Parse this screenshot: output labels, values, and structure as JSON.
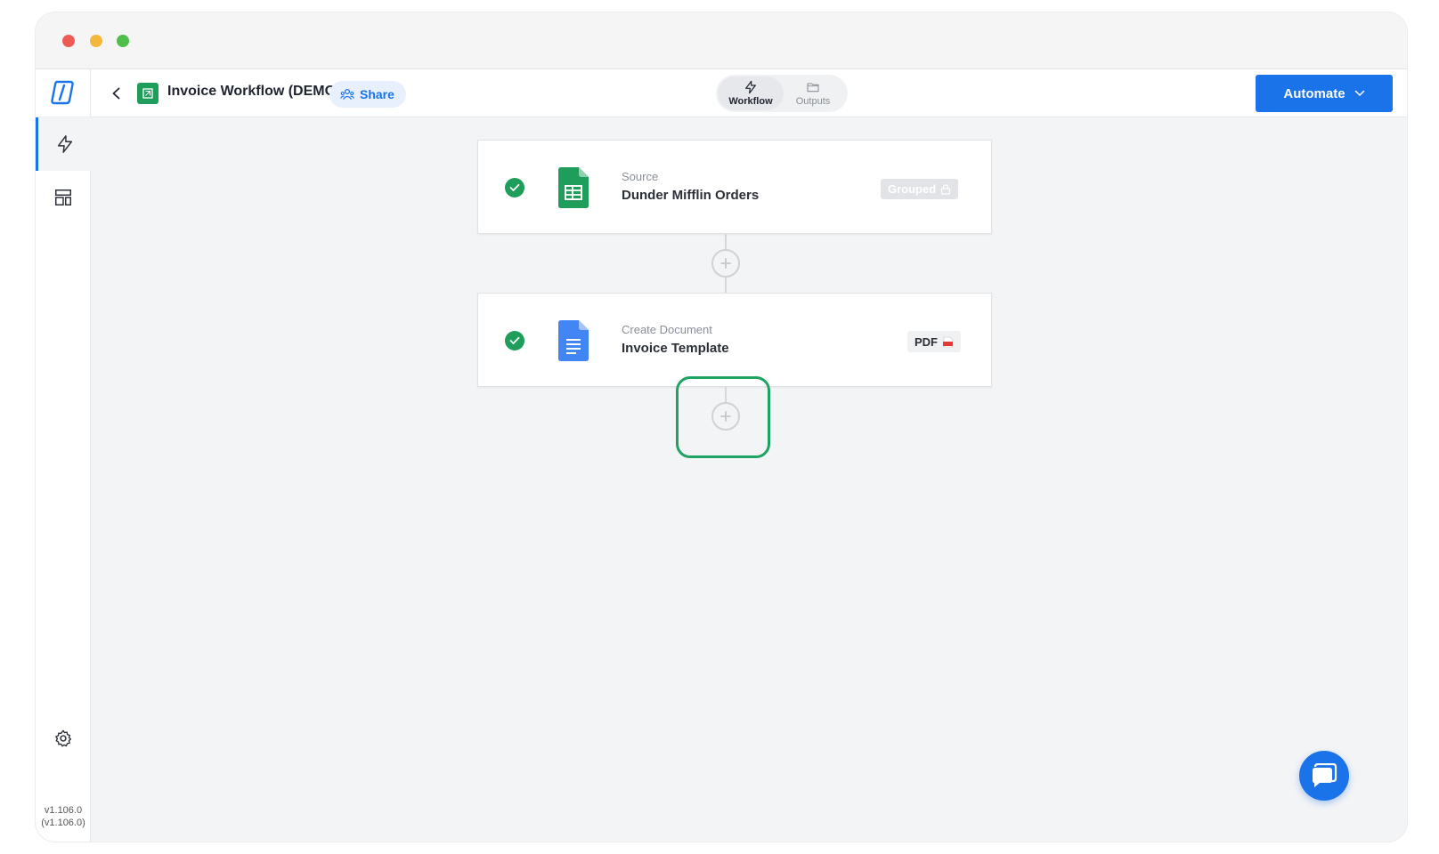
{
  "window": {
    "controls": [
      "close",
      "minimize",
      "zoom"
    ]
  },
  "sidebar": {
    "logo": "app-logo-icon",
    "items": [
      {
        "name": "workflow",
        "icon": "lightning-icon",
        "active": true
      },
      {
        "name": "templates",
        "icon": "layout-icon",
        "active": false
      }
    ],
    "settings_icon": "gear-icon",
    "version": "v1.106.0",
    "build": "(v1.106.0)"
  },
  "header": {
    "title": "Invoice Workflow (DEMO)",
    "share_label": "Share",
    "tabs": [
      {
        "label": "Workflow",
        "icon": "lightning-icon",
        "active": true
      },
      {
        "label": "Outputs",
        "icon": "folder-icon",
        "active": false
      }
    ],
    "automate_label": "Automate"
  },
  "steps": [
    {
      "kicker": "Source",
      "title": "Dunder Mifflin Orders",
      "badge": "Grouped",
      "app_icon": "google-sheets-icon",
      "status": "complete"
    },
    {
      "kicker": "Create Document",
      "title": "Invoice Template",
      "badge": "PDF",
      "app_icon": "google-docs-icon",
      "status": "complete"
    }
  ],
  "colors": {
    "accent": "#1a73e8",
    "success": "#1e9e5a",
    "highlight": "#1ea362"
  }
}
